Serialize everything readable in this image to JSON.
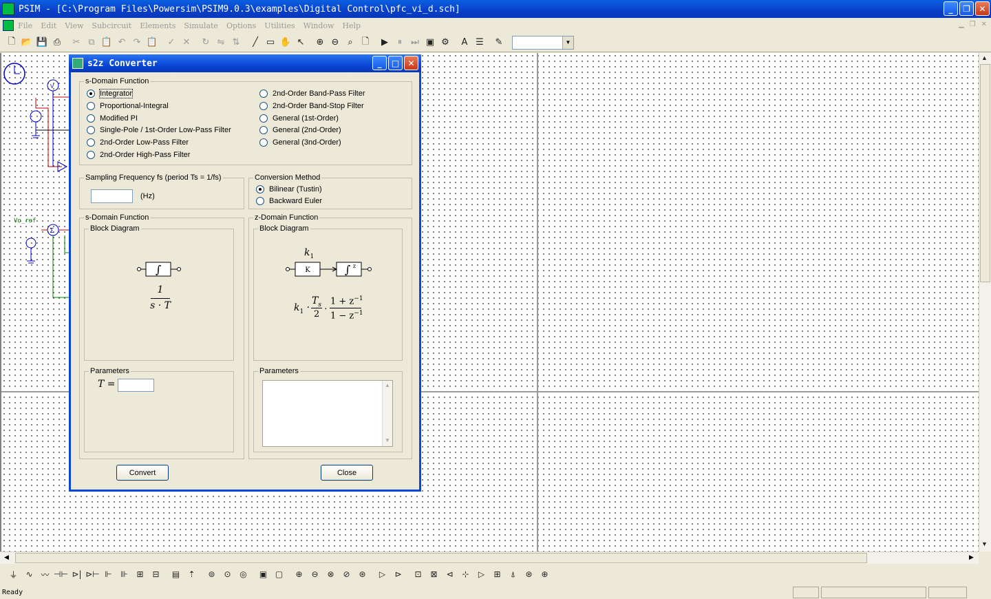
{
  "app": {
    "title": "PSIM - [C:\\Program Files\\Powersim\\PSIM9.0.3\\examples\\Digital Control\\pfc_vi_d.sch]",
    "window_buttons": [
      "_",
      "❐",
      "✕"
    ]
  },
  "menu": [
    "File",
    "Edit",
    "View",
    "Subcircuit",
    "Elements",
    "Simulate",
    "Options",
    "Utilities",
    "Window",
    "Help"
  ],
  "status": {
    "text": "Ready"
  },
  "schematic": {
    "label_vo_ref": "Vo_ref",
    "label_v": "V",
    "label_sum": "Σ"
  },
  "dialog": {
    "title": "s2z Converter",
    "sdomain_group": "s-Domain Function",
    "functions_left": [
      "Integrator",
      "Proportional-Integral",
      "Modified PI",
      "Single-Pole / 1st-Order Low-Pass Filter",
      "2nd-Order Low-Pass Filter",
      "2nd-Order High-Pass Filter"
    ],
    "functions_right": [
      "2nd-Order Band-Pass Filter",
      "2nd-Order Band-Stop Filter",
      "General (1st-Order)",
      "General (2nd-Order)",
      "General (3nd-Order)"
    ],
    "selected_function": "Integrator",
    "sampling": {
      "label": "Sampling Frequency fs (period Ts = 1/fs)",
      "value": "",
      "unit": "(Hz)"
    },
    "conversion": {
      "label": "Conversion Method",
      "options": [
        "Bilinear (Tustin)",
        "Backward Euler"
      ],
      "selected": "Bilinear (Tustin)"
    },
    "s_panel": {
      "title": "s-Domain Function",
      "diagram_label": "Block Diagram",
      "integrator_glyph": "∫",
      "formula_num": "1",
      "formula_den": "s · T",
      "params_label": "Parameters",
      "param_T_label": "T =",
      "param_T_value": ""
    },
    "z_panel": {
      "title": "z-Domain Function",
      "diagram_label": "Block Diagram",
      "gain_label": "k",
      "gain_sub": "1",
      "gain_box": "K",
      "z_block": "∫",
      "z_sup": "z",
      "formula_k": "k",
      "formula_k_sub": "1",
      "formula_ts": "T",
      "formula_ts_sub": "s",
      "formula_two": "2",
      "formula_num": "1 + z",
      "formula_den": "1 − z",
      "formula_exp": "−1",
      "params_label": "Parameters"
    },
    "convert_label": "Convert",
    "close_label": "Close"
  }
}
